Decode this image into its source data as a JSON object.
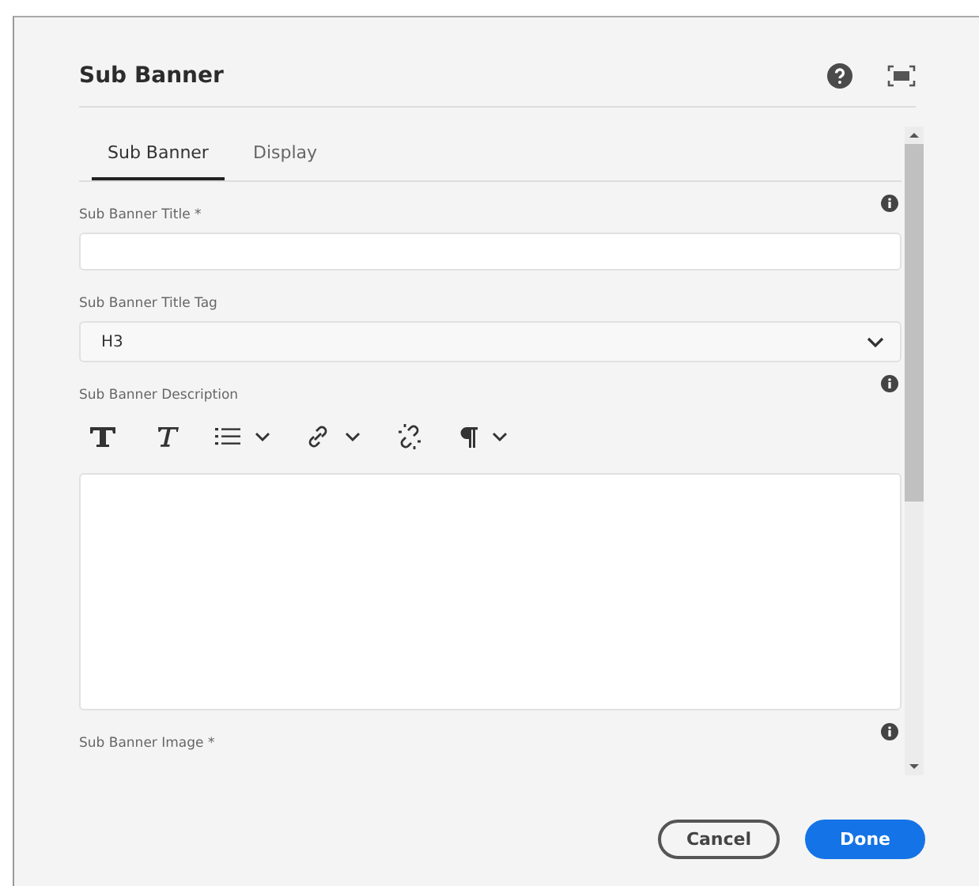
{
  "dialog": {
    "title": "Sub Banner"
  },
  "tabs": [
    {
      "label": "Sub Banner",
      "selected": true
    },
    {
      "label": "Display",
      "selected": false
    }
  ],
  "fields": [
    {
      "kind": "text",
      "label": "Sub Banner Title *",
      "info": true
    },
    {
      "kind": "select",
      "label": "Sub Banner Title Tag",
      "value": "H3",
      "info": false
    },
    {
      "kind": "richtext",
      "label": "Sub Banner Description",
      "info": true
    },
    {
      "kind": "image",
      "label": "Sub Banner Image *",
      "info": true
    }
  ],
  "buttons": [
    {
      "label": "Cancel",
      "kind": "secondary"
    },
    {
      "label": "Done",
      "kind": "primary"
    }
  ]
}
